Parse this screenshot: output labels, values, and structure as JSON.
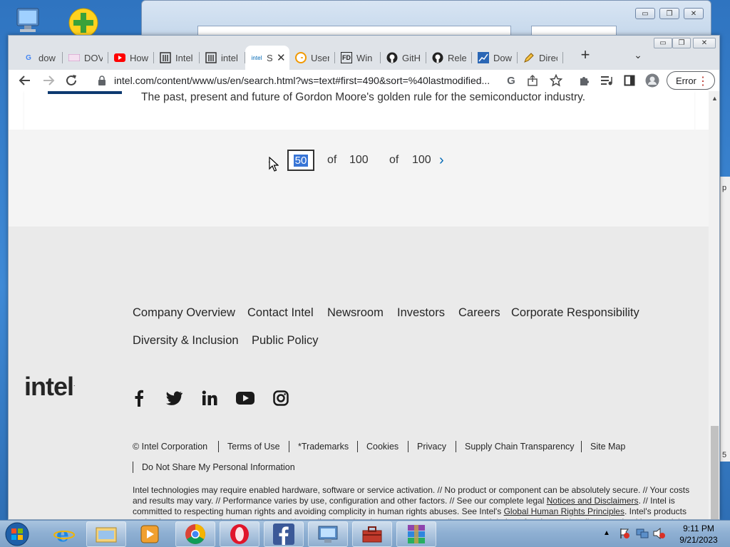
{
  "browser": {
    "tabs": [
      {
        "title": "dow",
        "icon": "google-icon"
      },
      {
        "title": "DOV",
        "icon": "site-icon"
      },
      {
        "title": "How",
        "icon": "youtube-icon"
      },
      {
        "title": "Intel",
        "icon": "library-icon"
      },
      {
        "title": "intel",
        "icon": "library-icon"
      },
      {
        "title": "S",
        "icon": "intel-icon",
        "active": true
      },
      {
        "title": "User",
        "icon": "clock-icon"
      },
      {
        "title": "Win",
        "icon": "fd-icon"
      },
      {
        "title": "GitH",
        "icon": "github-icon"
      },
      {
        "title": "Rele",
        "icon": "github-icon"
      },
      {
        "title": "Dow",
        "icon": "chart-icon"
      },
      {
        "title": "Direc",
        "icon": "pen-icon"
      }
    ],
    "active_tab_favicon_text": "intel",
    "url": "intel.com/content/www/us/en/search.html?ws=text#first=490&sort=%40lastmodified...",
    "profile_label": "Error"
  },
  "result": {
    "description": "The past, present and future of Gordon Moore's golden rule for the semiconductor industry."
  },
  "pager": {
    "current_page": "50",
    "of_label_1": "of",
    "total_1": "100",
    "of_label_2": "of",
    "total_2": "100"
  },
  "footer": {
    "nav_links": [
      "Company Overview",
      "Contact Intel",
      "Newsroom",
      "Investors",
      "Careers",
      "Corporate Responsibility",
      "Diversity & Inclusion",
      "Public Policy"
    ],
    "social": [
      "facebook-icon",
      "twitter-icon",
      "linkedin-icon",
      "youtube-icon",
      "instagram-icon"
    ],
    "logo_text": "intel",
    "links": [
      "© Intel Corporation",
      "Terms of Use",
      "*Trademarks",
      "Cookies",
      "Privacy",
      "Supply Chain Transparency",
      "Site Map",
      "Do Not Share My Personal Information"
    ],
    "legal_part1": "Intel technologies may require enabled hardware, software or service activation. // No product or component can be absolutely secure. // Your costs and results may vary. // Performance varies by use, configuration and other factors. // See our complete legal ",
    "legal_link1": "Notices and Disclaimers",
    "legal_part2": ". // Intel is committed to respecting human rights and avoiding complicity in human rights abuses. See Intel's ",
    "legal_link2": "Global Human Rights Principles",
    "legal_part3": ". Intel's products and software are intended only to be used in applications that do not cause or contribute to a violation of an internationally recognized human right."
  },
  "taskbar": {
    "apps": [
      "ie-icon",
      "explorer-icon",
      "media-player-icon",
      "chrome-icon",
      "opera-icon",
      "facebook-icon",
      "control-panel-icon",
      "toolbox-icon",
      "winrar-icon"
    ],
    "time": "9:11 PM",
    "date": "9/21/2023"
  },
  "colors": {
    "intel_blue": "#0068b5",
    "footer_bg": "#eaeaea",
    "selection": "#3875d6"
  }
}
